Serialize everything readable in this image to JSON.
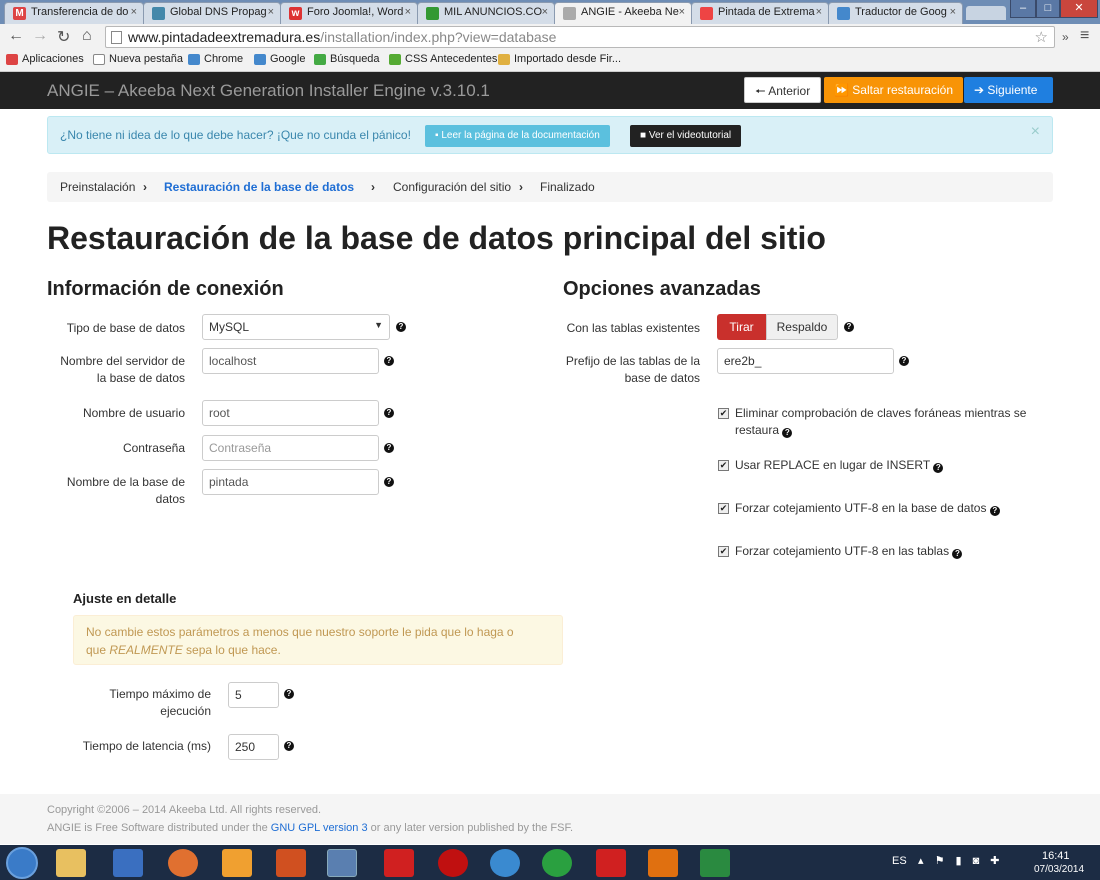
{
  "browser": {
    "tabs": [
      {
        "title": "Transferencia de do",
        "favicon_color": "#d44"
      },
      {
        "title": "Global DNS Propag",
        "favicon_color": "#48a"
      },
      {
        "title": "Foro Joomla!, Word",
        "favicon_color": "#d33"
      },
      {
        "title": "MIL ANUNCIOS.CO",
        "favicon_color": "#393"
      },
      {
        "title": "ANGIE - Akeeba Ne",
        "favicon_color": "#aaa",
        "active": true
      },
      {
        "title": "Pintada de Extrema",
        "favicon_color": "#e44"
      },
      {
        "title": "Traductor de Goog",
        "favicon_color": "#48c"
      }
    ],
    "close_glyph": "×",
    "url_host": "www.pintadadeextremadura.es",
    "url_path": "/installation/index.php?view=database",
    "bookmarks": [
      {
        "label": "Aplicaciones",
        "color": "#d44"
      },
      {
        "label": "Nueva pestaña",
        "color": "#ddd"
      },
      {
        "label": "Chrome",
        "color": "#48c"
      },
      {
        "label": "Google",
        "color": "#48c"
      },
      {
        "label": "Búsqueda",
        "color": "#4a4"
      },
      {
        "label": "CSS Antecedentes",
        "color": "#5a3"
      },
      {
        "label": "Importado desde Fir...",
        "color": "#e0b040"
      }
    ]
  },
  "app": {
    "title": "ANGIE – Akeeba Next Generation Installer Engine v.3.10.1",
    "btn_prev": "Anterior",
    "btn_skip": "Saltar restauración",
    "btn_next": "Siguiente"
  },
  "alert": {
    "text": "¿No tiene ni idea de lo que debe hacer? ¡Que no cunda el pánico!",
    "doc_button": "Leer la página de la documentación",
    "video_button": "Ver el videotutorial",
    "close": "×"
  },
  "breadcrumb": [
    "Preinstalación",
    "Restauración de la base de datos",
    "Configuración del sitio",
    "Finalizado"
  ],
  "page_title": "Restauración de la base de datos principal del sitio",
  "connection": {
    "heading": "Información de conexión",
    "db_type_label": "Tipo de base de datos",
    "db_type_value": "MySQL",
    "server_label_1": "Nombre del servidor de",
    "server_label_2": "la base de datos",
    "server_value": "localhost",
    "user_label": "Nombre de usuario",
    "user_value": "root",
    "password_label": "Contraseña",
    "password_placeholder": "Contraseña",
    "dbname_label_1": "Nombre de la base de",
    "dbname_label_2": "datos",
    "dbname_value": "pintada"
  },
  "advanced": {
    "heading": "Opciones avanzadas",
    "tables_label": "Con las tablas existentes",
    "btn_drop": "Tirar",
    "btn_backup": "Respaldo",
    "prefix_label_1": "Prefijo de las tablas de la",
    "prefix_label_2": "base de datos",
    "prefix_value": "ere2b_",
    "opt1_line1": "Eliminar comprobación de claves foráneas mientras se",
    "opt1_line2": "restaura",
    "opt2": "Usar REPLACE en lugar de INSERT",
    "opt3": "Forzar cotejamiento UTF-8 en la base de datos",
    "opt4": "Forzar cotejamiento UTF-8 en las tablas",
    "check_glyph": "✔"
  },
  "finetune": {
    "heading": "Ajuste en detalle",
    "warning_1": "No cambie estos parámetros a menos que nuestro soporte le pida que lo haga o",
    "warning_2a": "que ",
    "warning_2b": "REALMENTE",
    "warning_2c": " sepa lo que hace.",
    "maxtime_label_1": "Tiempo máximo de",
    "maxtime_label_2": "ejecución",
    "maxtime_value": "5",
    "latency_label": "Tiempo de latencia (ms)",
    "latency_value": "250"
  },
  "footer": {
    "line1": "Copyright ©2006 – 2014 Akeeba Ltd. All rights reserved.",
    "line2a": "ANGIE is Free Software distributed under the ",
    "line2_link": "GNU GPL version 3",
    "line2b": " or any later version published by the FSF."
  },
  "taskbar": {
    "lang": "ES",
    "time": "16:41",
    "date": "07/03/2014"
  }
}
